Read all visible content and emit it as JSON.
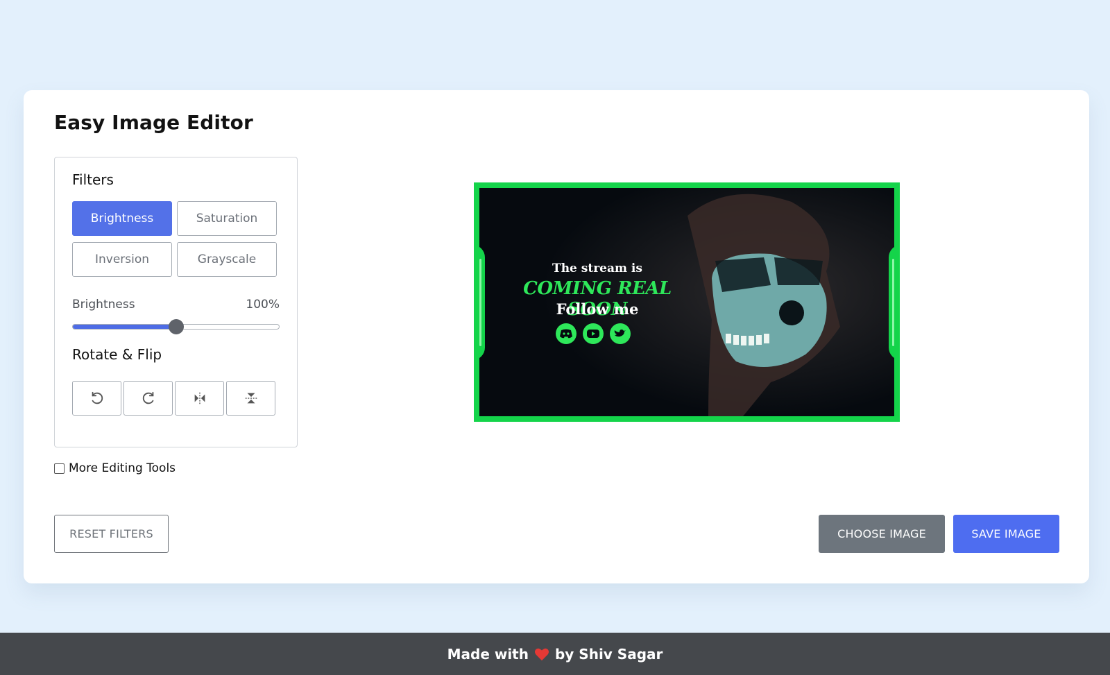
{
  "app": {
    "title": "Easy Image Editor"
  },
  "filters": {
    "heading": "Filters",
    "buttons": [
      "Brightness",
      "Saturation",
      "Inversion",
      "Grayscale"
    ],
    "active": "Brightness"
  },
  "slider": {
    "name": "Brightness",
    "value_label": "100%",
    "fraction": 0.5
  },
  "rotate_flip": {
    "heading": "Rotate & Flip"
  },
  "more_tools": {
    "label": "More Editing Tools",
    "checked": false
  },
  "buttons": {
    "reset": "RESET FILTERS",
    "choose": "CHOOSE IMAGE",
    "save": "SAVE IMAGE"
  },
  "preview": {
    "line1": "The stream is",
    "line2": "COMING REAL SOON",
    "line3": "Follow me",
    "icons": [
      "discord-icon",
      "youtube-icon",
      "twitter-icon"
    ]
  },
  "footer": {
    "prefix": "Made with",
    "suffix": "by Shiv Sagar"
  },
  "colors": {
    "accent": "#5371e8",
    "secondary": "#6d757d",
    "preview_border": "#14d44a",
    "heart": "#e53935",
    "footer_bg": "#45484c"
  }
}
